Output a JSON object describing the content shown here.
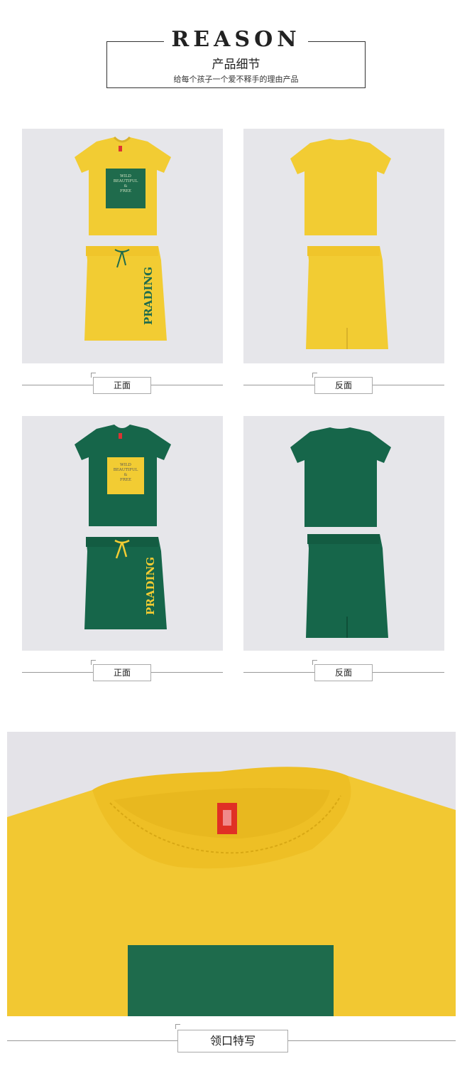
{
  "header": {
    "title": "REASON",
    "subtitle": "产品细节",
    "tagline": "给每个孩子一个爱不释手的理由产品"
  },
  "garment": {
    "front_print": [
      "WILD",
      "BEAUTIFUL",
      "&",
      "FREE"
    ],
    "skirt_print": "PRADING"
  },
  "colors": {
    "yellow": "#f2cc33",
    "green": "#16664a",
    "panel_bg": "#e6e6ea"
  },
  "panels": [
    {
      "caption": "正面",
      "color": "yellow",
      "view": "front"
    },
    {
      "caption": "反面",
      "color": "yellow",
      "view": "back"
    },
    {
      "caption": "正面",
      "color": "green",
      "view": "front"
    },
    {
      "caption": "反面",
      "color": "green",
      "view": "back"
    }
  ],
  "closeup": {
    "caption": "领口特写"
  }
}
